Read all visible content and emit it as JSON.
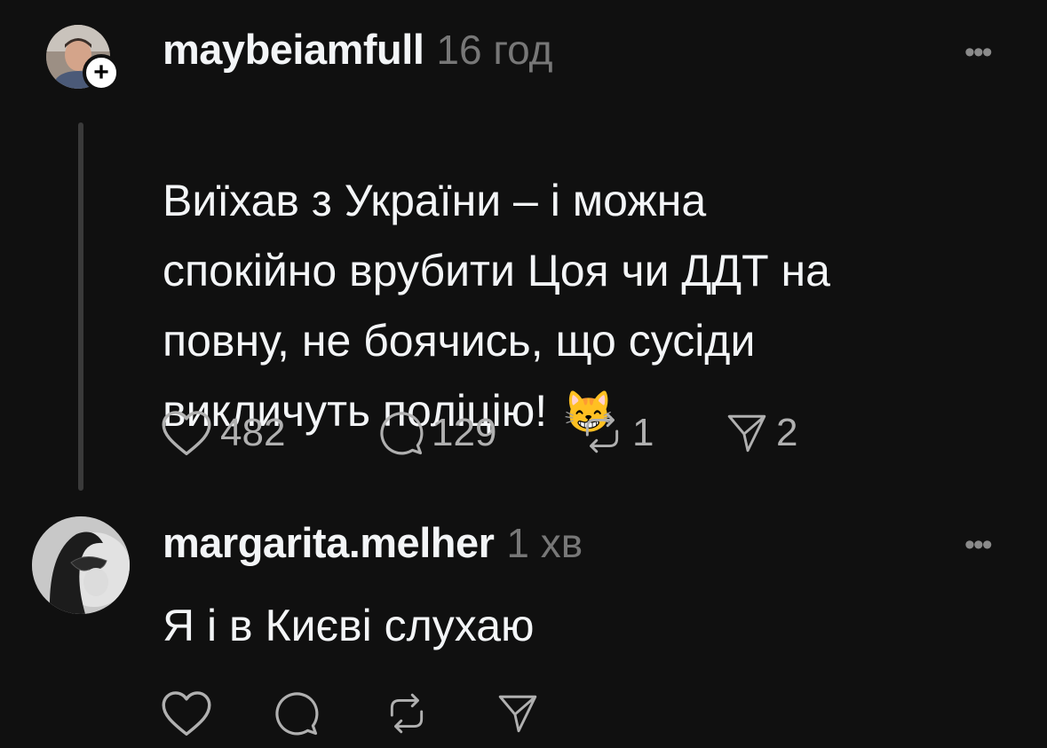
{
  "posts": [
    {
      "username": "maybeiamfull",
      "time": "16 год",
      "text": "Виїхав з України – і можна\nспокійно врубити Цоя чи ДДТ на\nповну, не боячись, що сусіди\nвикличуть поліцію!",
      "emoji": "😸",
      "likes": "482",
      "replies": "129",
      "reposts": "1",
      "shares": "2",
      "follow_symbol": "+",
      "more_symbol": "•••"
    },
    {
      "username": "margarita.melher",
      "time": "1 хв",
      "text": "Я і в Києві слухаю",
      "more_symbol": "•••"
    }
  ],
  "colors": {
    "background": "#101010",
    "text": "#f3f5f7",
    "muted": "#777777",
    "icon": "#b0b0b0"
  },
  "icons": [
    "heart-icon",
    "comment-icon",
    "repost-icon",
    "share-icon",
    "more-icon",
    "follow-plus-icon"
  ]
}
